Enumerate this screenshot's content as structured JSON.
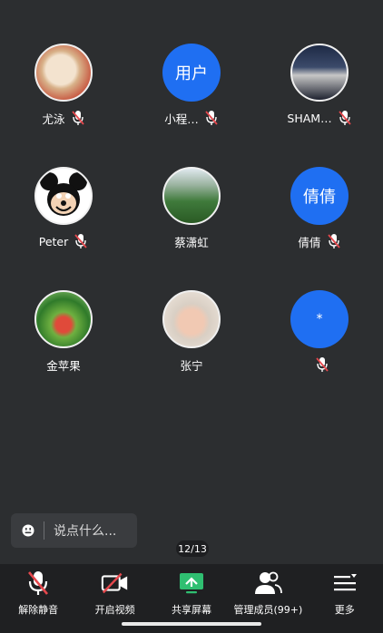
{
  "participants": [
    {
      "name": "尤泳",
      "avatar_text": "",
      "avatar_kind": "photo-food",
      "muted": true
    },
    {
      "name": "小程…",
      "avatar_text": "用户",
      "avatar_kind": "blue",
      "muted": true
    },
    {
      "name": "SHAM…",
      "avatar_text": "",
      "avatar_kind": "photo-dark",
      "muted": true
    },
    {
      "name": "Peter",
      "avatar_text": "",
      "avatar_kind": "photo-mickey",
      "muted": true
    },
    {
      "name": "蔡潇虹",
      "avatar_text": "",
      "avatar_kind": "photo-landscape",
      "muted": false
    },
    {
      "name": "倩倩",
      "avatar_text": "倩倩",
      "avatar_kind": "blue",
      "muted": true
    },
    {
      "name": "金苹果",
      "avatar_text": "",
      "avatar_kind": "photo-greens",
      "muted": false
    },
    {
      "name": "张宁",
      "avatar_text": "",
      "avatar_kind": "photo-baby",
      "muted": false
    },
    {
      "name": "",
      "avatar_text": "*",
      "avatar_kind": "blue",
      "muted": true
    }
  ],
  "chat": {
    "placeholder": "说点什么..."
  },
  "pager": {
    "text": "12/13"
  },
  "toolbar": {
    "unmute": "解除静音",
    "start_video": "开启视频",
    "share_screen": "共享屏幕",
    "manage_members": "管理成员(99+)",
    "more": "更多"
  },
  "colors": {
    "background": "#2c2e30",
    "toolbar": "#1f2022",
    "accent_blue": "#1f6ff2",
    "mute_red": "#e5484d",
    "share_green": "#2fbf71"
  }
}
